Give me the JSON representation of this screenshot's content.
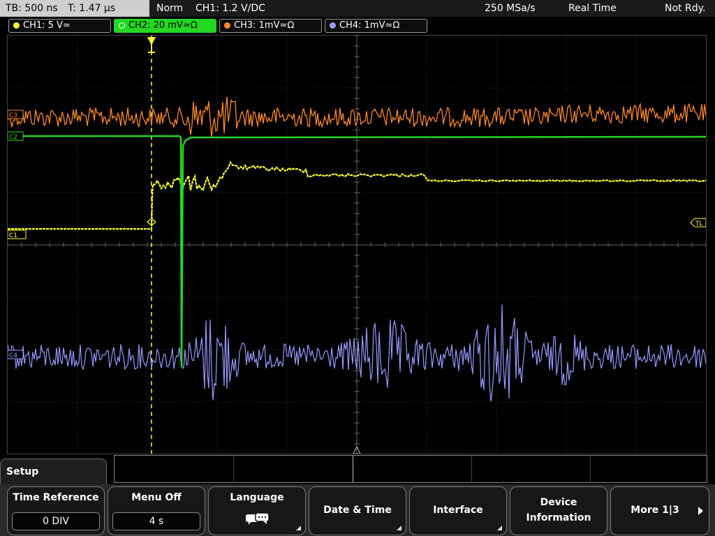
{
  "status": {
    "timebase": "TB: 500 ns",
    "trigger_time": "T: 1.47 µs",
    "trigger_mode": "Norm",
    "trigger_source": "CH1: 1.2 V∕DC",
    "sample_rate": "250 MSa/s",
    "acq_mode": "Real Time",
    "state": "Not Rdy."
  },
  "channels": [
    {
      "label": "CH1: 5 V≃",
      "color": "#ffff33",
      "active": false
    },
    {
      "label": "CH2: 20 mV≃Ω",
      "color": "#22d822",
      "active": true
    },
    {
      "label": "CH3: 1mV≃Ω",
      "color": "#ff8a2a",
      "active": false
    },
    {
      "label": "CH4: 1mV≃Ω",
      "color": "#9a9aff",
      "active": false
    }
  ],
  "screen": {
    "marker_c3": "C3",
    "marker_c2": "C2",
    "marker_c1": "C1",
    "marker_c4": "C4",
    "marker_tl": "TL",
    "grid_color": "#3a3a3a",
    "trigger_color": "#ffff33"
  },
  "menu": {
    "title": "Setup",
    "time_reference": {
      "label": "Time Reference",
      "value": "0 DIV"
    },
    "menu_off": {
      "label": "Menu Off",
      "value": "4 s"
    },
    "language": {
      "label": "Language",
      "icon": "speech-bubbles-icon"
    },
    "date_time": {
      "label": "Date & Time"
    },
    "interface": {
      "label": "Interface"
    },
    "device_information": {
      "label_line1": "Device",
      "label_line2": "Information"
    },
    "more": {
      "label": "More 1|3",
      "icon": "chevron-right-icon"
    }
  }
}
